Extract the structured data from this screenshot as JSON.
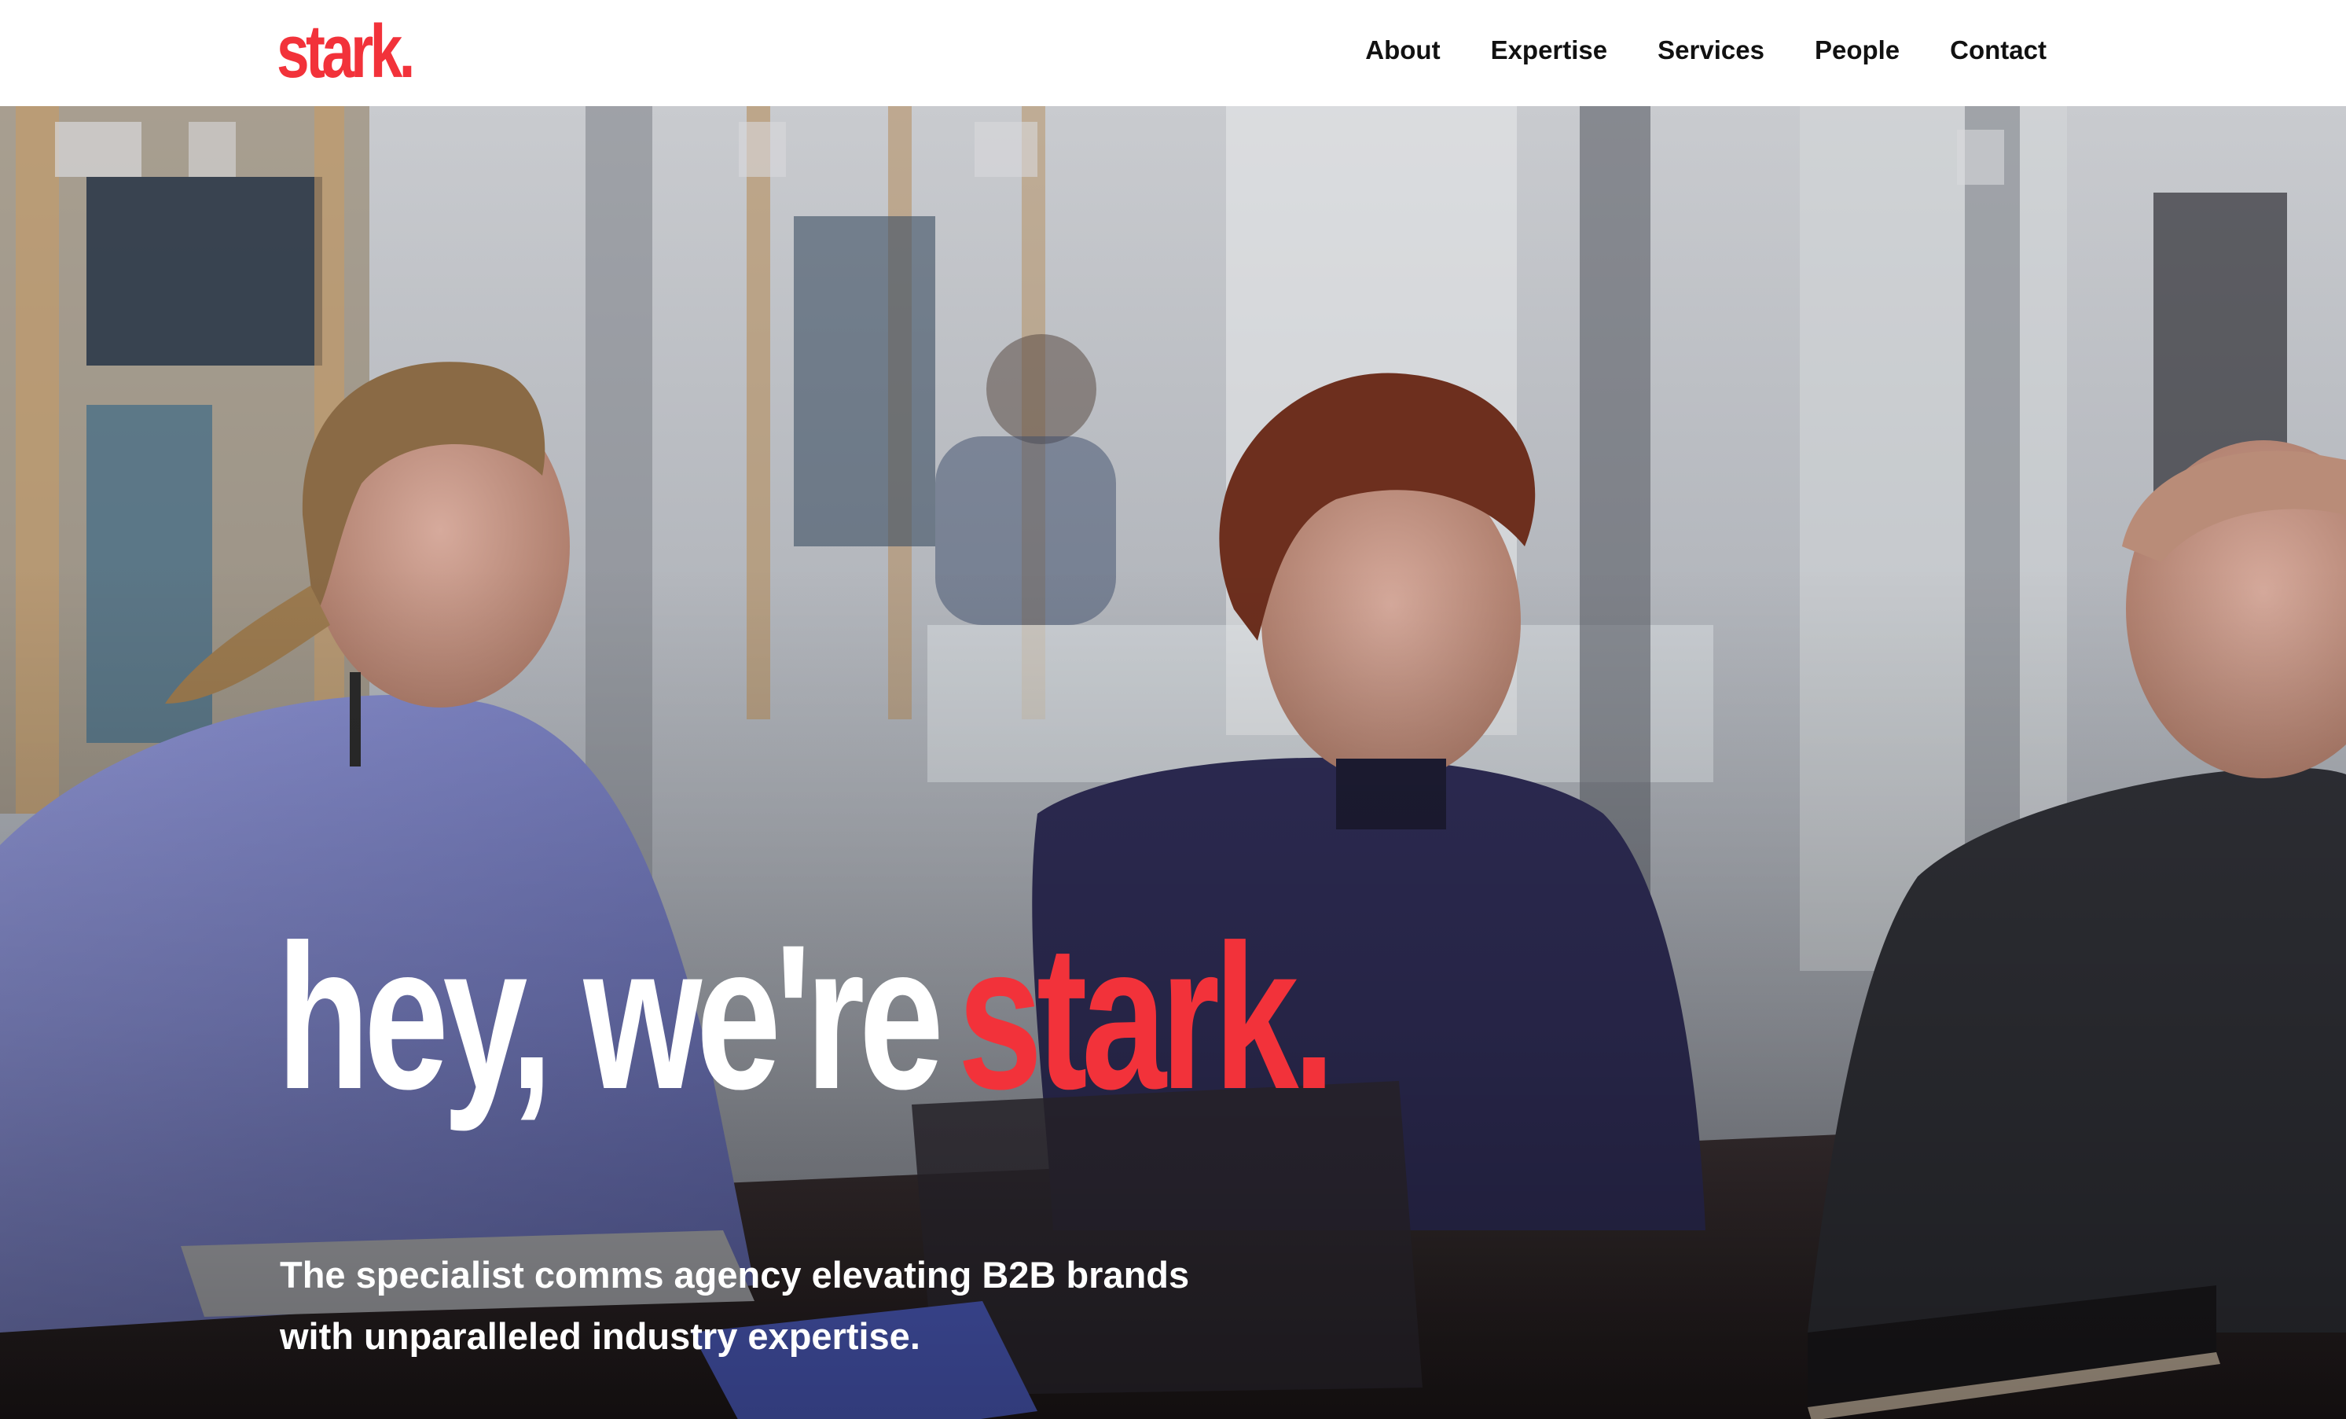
{
  "brand": {
    "logo_text": "stark.",
    "accent_color": "#f2323a"
  },
  "nav": {
    "items": [
      {
        "label": "About"
      },
      {
        "label": "Expertise"
      },
      {
        "label": "Services"
      },
      {
        "label": "People"
      },
      {
        "label": "Contact"
      }
    ]
  },
  "hero": {
    "headline_lead": "hey, we're",
    "headline_brand": "stark.",
    "tagline_line1": "The specialist comms agency elevating B2B brands",
    "tagline_line2": "with unparalleled industry expertise."
  }
}
